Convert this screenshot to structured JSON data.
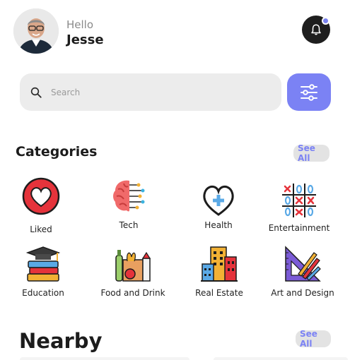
{
  "header": {
    "greeting": "Hello",
    "user_name": "Jesse"
  },
  "search": {
    "placeholder": "Search"
  },
  "categories": {
    "title": "Categories",
    "see_all": "See All",
    "items": [
      {
        "label": "Liked",
        "icon": "heart-icon"
      },
      {
        "label": "Tech",
        "icon": "brain-circuit-icon"
      },
      {
        "label": "Health",
        "icon": "health-heart-plus-icon"
      },
      {
        "label": "Entertainment",
        "icon": "tic-tac-toe-icon"
      },
      {
        "label": "Education",
        "icon": "books-graduation-cap-icon"
      },
      {
        "label": "Food and Drink",
        "icon": "grocery-bag-icon"
      },
      {
        "label": "Real Estate",
        "icon": "buildings-icon"
      },
      {
        "label": "Art and Design",
        "icon": "ruler-pencils-icon"
      }
    ]
  },
  "nearby": {
    "title": "Nearby",
    "see_all": "See All"
  },
  "colors": {
    "accent": "#7b82f4",
    "bell_bg": "#1e1e1e",
    "search_bg": "#ececec"
  }
}
